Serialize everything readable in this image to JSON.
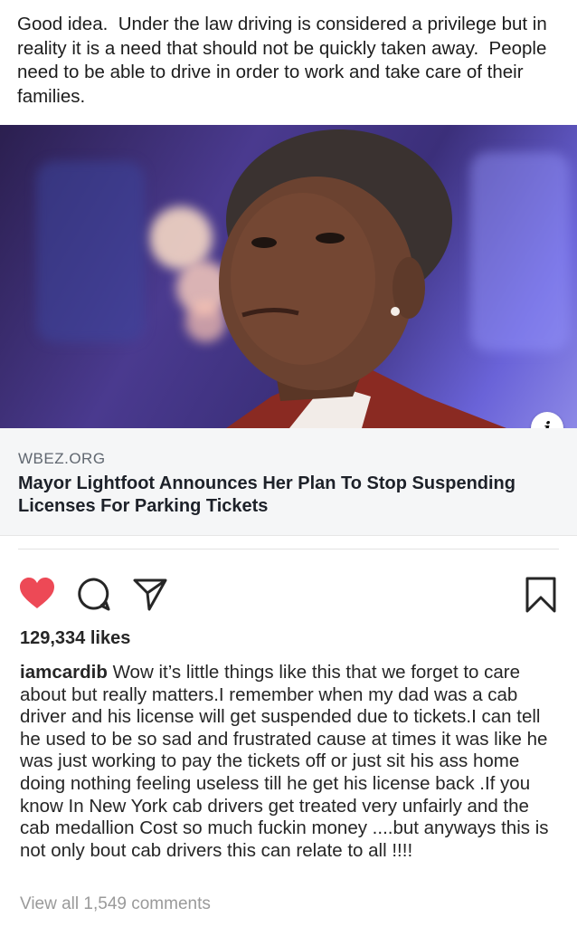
{
  "post": {
    "text": "Good idea.  Under the law driving is considered a privilege but in reality it is a need that should not be quickly taken away.  People need to be able to drive in order to work and take care of their families."
  },
  "link_preview": {
    "domain": "WBEZ.ORG",
    "title": "Mayor Lightfoot Announces Her Plan To Stop Suspending Licenses For Parking Tickets",
    "info_icon": "info-icon",
    "image": "photo-of-woman-portrait"
  },
  "actions": {
    "like_icon": "heart-icon",
    "like_color": "#ed4956",
    "comment_icon": "comment-icon",
    "share_icon": "share-icon",
    "save_icon": "bookmark-icon"
  },
  "likes": "129,334 likes",
  "caption": {
    "username": "iamcardib",
    "text": "Wow it’s little things like this that we forget to care about but really matters.I remember when my dad was a cab driver and his license will get suspended due to tickets.I can tell he used to be so sad and frustrated cause at times it was like he was just working to pay the tickets off or just sit his ass home doing nothing feeling useless till he get his license back .If you know In New York cab drivers get treated very unfairly and the cab medallion Cost so much fuckin money ....but anyways this is not only bout cab drivers this can relate to all !!!!"
  },
  "comments": {
    "view_all": "View all 1,549 comments"
  }
}
